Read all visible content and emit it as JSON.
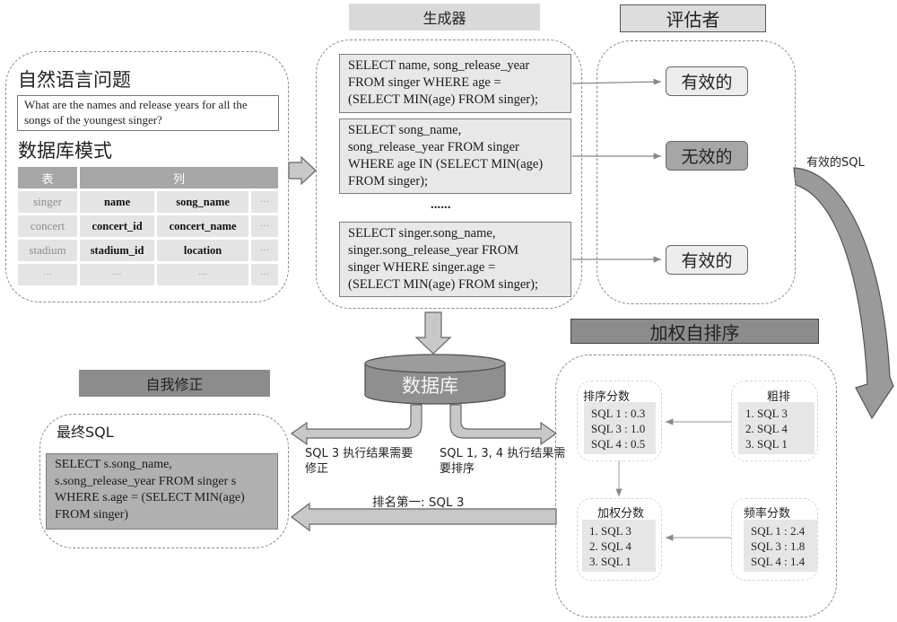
{
  "sections": {
    "generator": "生成器",
    "evaluator": "评估者",
    "weighted_reranking": "加权自排序",
    "self_correction": "自我修正"
  },
  "input": {
    "question_title": "自然语言问题",
    "question_lines": [
      "What are the names and release years for all the",
      "songs of the youngest singer?"
    ],
    "schema_title": "数据库模式",
    "schema_headers": {
      "table": "表",
      "columns": "列"
    },
    "schema_rows": [
      {
        "table": "singer",
        "col1": "name",
        "col2": "song_name",
        "more": "···"
      },
      {
        "table": "concert",
        "col1": "concert_id",
        "col2": "concert_name",
        "more": "···"
      },
      {
        "table": "stadium",
        "col1": "stadium_id",
        "col2": "location",
        "more": "···"
      },
      {
        "table": "···",
        "col1": "···",
        "col2": "···",
        "more": "···"
      }
    ]
  },
  "generator": {
    "candidates": [
      {
        "lines": [
          "SELECT name, song_release_year",
          "FROM singer WHERE age =",
          "(SELECT MIN(age) FROM singer);"
        ]
      },
      {
        "lines": [
          "SELECT song_name,",
          "song_release_year FROM singer",
          "WHERE age IN (SELECT MIN(age)",
          "FROM singer);"
        ]
      },
      {
        "lines": [
          "SELECT singer.song_name,",
          "singer.song_release_year FROM",
          "singer WHERE singer.age =",
          "(SELECT MIN(age) FROM singer);"
        ]
      }
    ],
    "ellipsis": "......"
  },
  "evaluator": {
    "verdicts": [
      {
        "label": "有效的",
        "status": "valid"
      },
      {
        "label": "无效的",
        "status": "invalid"
      },
      {
        "label": "有效的",
        "status": "valid"
      }
    ],
    "valid_sql_label": "有效的SQL"
  },
  "database": {
    "label": "数据库",
    "left_note": [
      "SQL 3 执行结果需要",
      "修正"
    ],
    "right_note": [
      "SQL 1, 3, 4 执行结果需",
      "要排序"
    ],
    "rank_first_label": "排名第一: SQL 3"
  },
  "reranking": {
    "rough_rank": {
      "title": "粗排",
      "items": [
        "1. SQL 3",
        "2. SQL 4",
        "3. SQL 1"
      ]
    },
    "rank_score": {
      "title": "排序分数",
      "items": [
        "SQL 1 : 0.3",
        "SQL 3 : 1.0",
        "SQL 4 : 0.5"
      ]
    },
    "frequency_score": {
      "title": "频率分数",
      "items": [
        "SQL 1 : 2.4",
        "SQL 3 : 1.8",
        "SQL 4 : 1.4"
      ]
    },
    "weighted_score": {
      "title": "加权分数",
      "items": [
        "1. SQL 3",
        "2. SQL 4",
        "3. SQL 1"
      ]
    }
  },
  "final": {
    "title": "最终SQL",
    "lines": [
      "SELECT s.song_name,",
      "s.song_release_year FROM singer s",
      "WHERE s.age = (SELECT MIN(age)",
      "FROM singer)"
    ]
  },
  "colors": {
    "light_fill": "#e8e8e8",
    "mid_fill": "#a6a6a6",
    "dark_fill": "#8c8c8c",
    "dashed_border": "#8a8a8a"
  }
}
